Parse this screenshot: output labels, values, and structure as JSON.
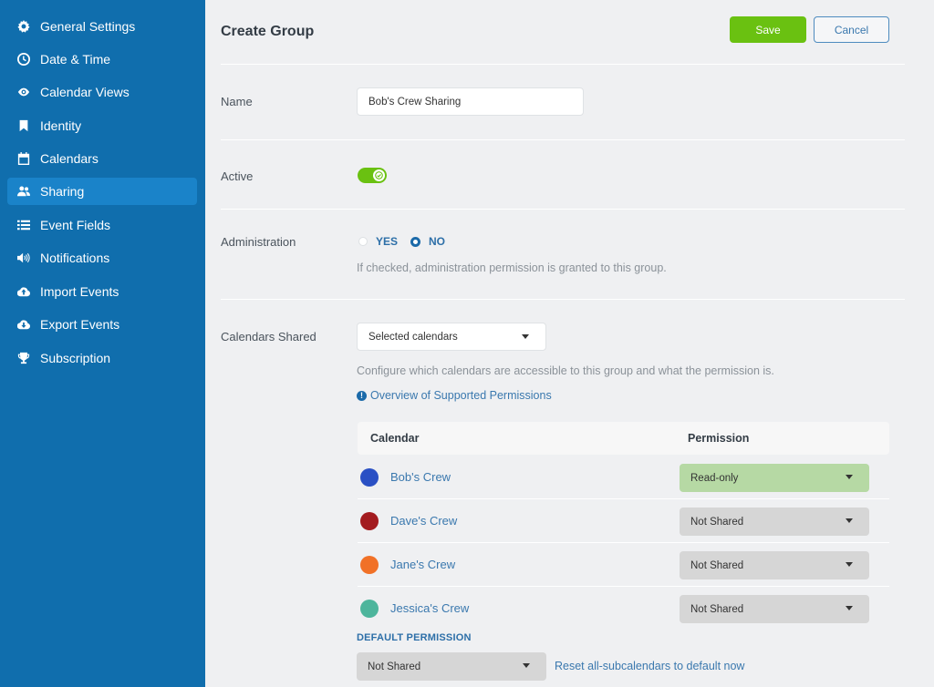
{
  "sidebar": {
    "items": [
      {
        "label": "General Settings",
        "icon": "gear-icon",
        "active": false
      },
      {
        "label": "Date & Time",
        "icon": "clock-icon",
        "active": false
      },
      {
        "label": "Calendar Views",
        "icon": "eye-icon",
        "active": false
      },
      {
        "label": "Identity",
        "icon": "bookmark-icon",
        "active": false
      },
      {
        "label": "Calendars",
        "icon": "calendar-icon",
        "active": false
      },
      {
        "label": "Sharing",
        "icon": "users-icon",
        "active": true
      },
      {
        "label": "Event Fields",
        "icon": "list-icon",
        "active": false
      },
      {
        "label": "Notifications",
        "icon": "speaker-icon",
        "active": false
      },
      {
        "label": "Import Events",
        "icon": "cloud-upload-icon",
        "active": false
      },
      {
        "label": "Export Events",
        "icon": "cloud-download-icon",
        "active": false
      },
      {
        "label": "Subscription",
        "icon": "trophy-icon",
        "active": false
      }
    ]
  },
  "header": {
    "title": "Create Group",
    "save_label": "Save",
    "cancel_label": "Cancel"
  },
  "form": {
    "name": {
      "label": "Name",
      "value": "Bob's Crew Sharing"
    },
    "active": {
      "label": "Active",
      "on": true
    },
    "administration": {
      "label": "Administration",
      "options": [
        "YES",
        "NO"
      ],
      "selected": "NO",
      "help": "If checked, administration permission is granted to this group."
    },
    "calendars_shared": {
      "label": "Calendars Shared",
      "selected": "Selected calendars",
      "help": "Configure which calendars are accessible to this group and what the permission is.",
      "overview_link": "Overview of Supported Permissions",
      "table": {
        "col_calendar": "Calendar",
        "col_permission": "Permission",
        "rows": [
          {
            "name": "Bob's Crew",
            "color": "#2a50c4",
            "permission": "Read-only"
          },
          {
            "name": "Dave's Crew",
            "color": "#a31b1f",
            "permission": "Not Shared"
          },
          {
            "name": "Jane's Crew",
            "color": "#f17127",
            "permission": "Not Shared"
          },
          {
            "name": "Jessica's Crew",
            "color": "#4db59c",
            "permission": "Not Shared"
          }
        ]
      },
      "default_permission_label": "DEFAULT PERMISSION",
      "default_permission": "Not Shared",
      "reset_link": "Reset all-subcalendars to default now"
    }
  },
  "colors": {
    "sidebar_bg": "#106ead",
    "sidebar_active": "#1a83c9",
    "save_green": "#6ac111",
    "link_blue": "#3a78ae",
    "readonly_green": "#b6d9a4",
    "not_shared_gray": "#d6d6d6"
  }
}
